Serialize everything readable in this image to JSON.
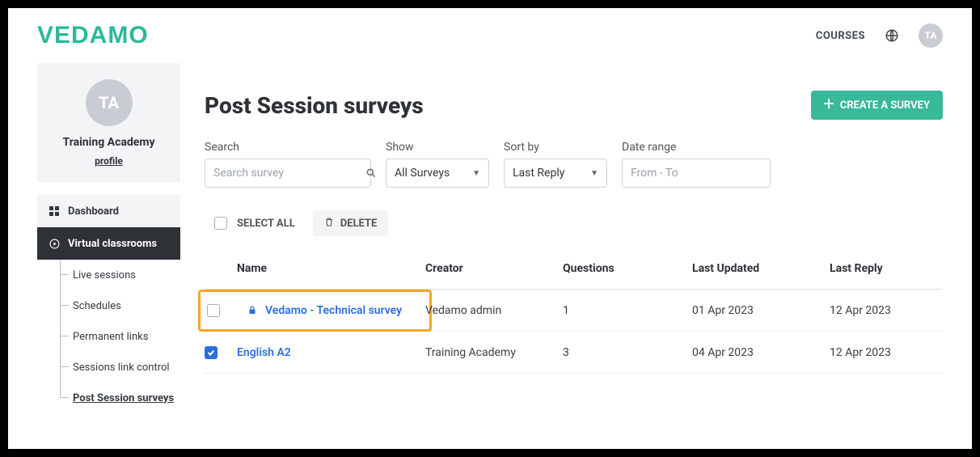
{
  "brand": {
    "logo": "VEDAMO"
  },
  "topbar": {
    "courses_label": "COURSES",
    "avatar_initials": "TA"
  },
  "sidebar": {
    "profile": {
      "avatar_initials": "TA",
      "org_name": "Training Academy",
      "profile_link": "profile"
    },
    "nav": {
      "dashboard": "Dashboard",
      "virtual_classrooms": "Virtual classrooms",
      "sub": {
        "live_sessions": "Live sessions",
        "schedules": "Schedules",
        "permanent_links": "Permanent links",
        "sessions_link_control": "Sessions link control",
        "post_session_surveys": "Post Session surveys"
      }
    }
  },
  "page": {
    "title": "Post Session surveys",
    "create_button": "CREATE A SURVEY"
  },
  "filters": {
    "search": {
      "label": "Search",
      "placeholder": "Search survey"
    },
    "show": {
      "label": "Show",
      "value": "All Surveys"
    },
    "sort": {
      "label": "Sort by",
      "value": "Last Reply"
    },
    "daterange": {
      "label": "Date range",
      "placeholder": "From - To"
    }
  },
  "actions": {
    "select_all": "SELECT ALL",
    "delete": "DELETE"
  },
  "table": {
    "headers": {
      "name": "Name",
      "creator": "Creator",
      "questions": "Questions",
      "last_updated": "Last Updated",
      "last_reply": "Last Reply"
    },
    "rows": [
      {
        "checked": false,
        "locked": true,
        "highlighted": true,
        "name": "Vedamo - Technical survey",
        "creator": "Vedamo admin",
        "questions": "1",
        "last_updated": "01 Apr 2023",
        "last_reply": "12 Apr 2023"
      },
      {
        "checked": true,
        "locked": false,
        "highlighted": false,
        "name": "English A2",
        "creator": "Training Academy",
        "questions": "3",
        "last_updated": "04 Apr 2023",
        "last_reply": "12 Apr 2023"
      }
    ]
  }
}
